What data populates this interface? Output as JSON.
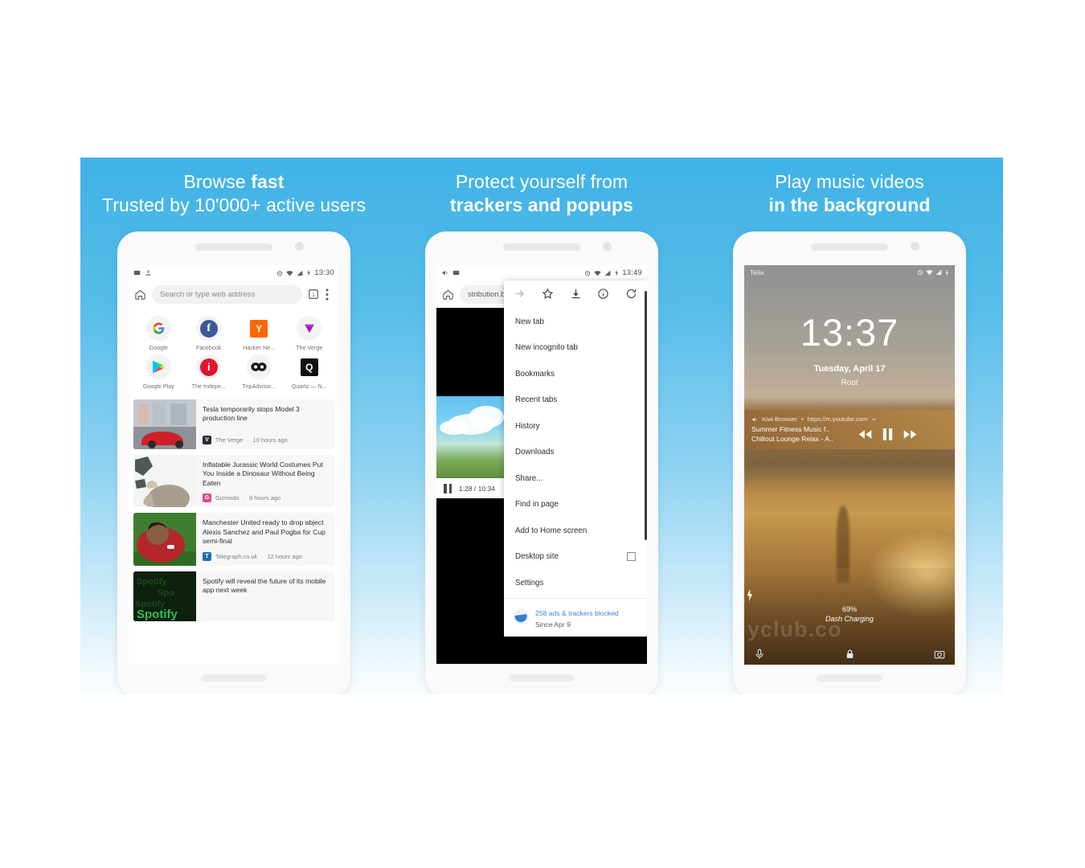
{
  "panels": [
    {
      "headline_line1": "Browse fast",
      "headline_line1_plain": "Browse ",
      "headline_line1_bold": "fast",
      "headline_line2_plain": "Trusted by 10'000+ active users",
      "headline_line2_bold": ""
    },
    {
      "headline_line1_plain": "Protect yourself from",
      "headline_line2_bold": "trackers and popups"
    },
    {
      "headline_line1_plain": "Play music videos",
      "headline_line2_bold": "in the background"
    }
  ],
  "phone1": {
    "status": {
      "time": "13:30",
      "icons": [
        "screenshot-icon",
        "download-icon",
        "alarm-icon",
        "wifi-icon",
        "signal-icon",
        "battery-charging-icon"
      ]
    },
    "toolbar": {
      "home_icon": "home-icon",
      "omnibox_placeholder": "Search or type web address",
      "tabs_icon": "tab-switcher-icon",
      "menu_icon": "overflow-menu-icon"
    },
    "tiles": [
      {
        "label": "Google",
        "glyph": "G",
        "kind": "google"
      },
      {
        "label": "Facebook",
        "glyph": "f",
        "kind": "facebook"
      },
      {
        "label": "Hacker Ne...",
        "glyph": "Y",
        "kind": "hackernews"
      },
      {
        "label": "The Verge",
        "glyph": "V",
        "kind": "verge"
      },
      {
        "label": "Google Play",
        "glyph": "▶",
        "kind": "googleplay"
      },
      {
        "label": "The Indepe...",
        "glyph": "ⓨ",
        "kind": "independent"
      },
      {
        "label": "TripAdvisor...",
        "glyph": "◉◉",
        "kind": "tripadvisor"
      },
      {
        "label": "Quartz — N...",
        "glyph": "Q",
        "kind": "quartz"
      }
    ],
    "articles": [
      {
        "title": "Tesla temporarily stops Model 3 production line",
        "source": "The Verge",
        "age": "10 hours ago",
        "favicon_glyph": "V",
        "favicon_color": "#2b2b3a",
        "thumb": "tesla-red-car-photo"
      },
      {
        "title": "Inflatable Jurassic World Costumes Put You Inside a Dinosaur Without Being Eaten",
        "source": "Gizmodo",
        "age": "9 hours ago",
        "favicon_glyph": "G",
        "favicon_color": "#d94c8e",
        "thumb": "dinosaur-photo"
      },
      {
        "title": "Manchester United ready to drop abject Alexis Sanchez and Paul Pogba for Cup semi-final",
        "source": "Telegraph.co.uk",
        "age": "12 hours ago",
        "favicon_glyph": "T",
        "favicon_color": "#1f6fb2",
        "thumb": "footballer-photo"
      },
      {
        "title": "Spotify will reveal the future of its mobile app next week",
        "source": "",
        "age": "",
        "favicon_glyph": "",
        "favicon_color": "",
        "thumb": "spotify-logo-photo"
      }
    ],
    "meta_separator": "·"
  },
  "phone2": {
    "status": {
      "time": "13:49",
      "icons": [
        "volume-icon",
        "screenshot-icon",
        "alarm-icon",
        "wifi-icon",
        "signal-icon",
        "battery-charging-icon"
      ]
    },
    "toolbar": {
      "home_icon": "home-icon",
      "url": "stribution.bb"
    },
    "video": {
      "position": "1:28 / 10:34",
      "play_state_icon": "pause-icon"
    },
    "menu": {
      "top_icons": [
        "forward-arrow-icon",
        "bookmark-star-icon",
        "download-icon",
        "page-info-icon",
        "reload-icon"
      ],
      "items": [
        {
          "label": "New tab",
          "checkbox": false
        },
        {
          "label": "New incognito tab",
          "checkbox": false
        },
        {
          "label": "Bookmarks",
          "checkbox": false
        },
        {
          "label": "Recent tabs",
          "checkbox": false
        },
        {
          "label": "History",
          "checkbox": false
        },
        {
          "label": "Downloads",
          "checkbox": false
        },
        {
          "label": "Share...",
          "checkbox": false
        },
        {
          "label": "Find in page",
          "checkbox": false
        },
        {
          "label": "Add to Home screen",
          "checkbox": false
        },
        {
          "label": "Desktop site",
          "checkbox": true
        },
        {
          "label": "Settings",
          "checkbox": false
        }
      ],
      "footer_line1": "258 ads & trackers blocked",
      "footer_line2": "Since Apr 9",
      "footer_icon": "kiwi-browser-icon",
      "footer_link_color": "#3f82d8"
    }
  },
  "phone3": {
    "status": {
      "carrier": "Telia",
      "icons": [
        "alarm-icon",
        "wifi-icon",
        "signal-icon",
        "battery-charging-icon"
      ]
    },
    "clock": {
      "time": "13:37",
      "date": "Tuesday, April 17",
      "owner": "Root"
    },
    "media": {
      "app": "Kiwi Browser",
      "separator": "•",
      "url": "https://m.youtube.com",
      "expand_icon": "chevron-down-icon",
      "volume_icon": "volume-icon",
      "title_line1": "Summer Fitness Music f..",
      "title_line2": "Chillout Lounge Relax - A..",
      "controls": [
        "rewind-icon",
        "pause-icon",
        "fast-forward-icon"
      ]
    },
    "charging": {
      "bolt_icon": "charging-bolt-icon",
      "percent": "69%",
      "label": "Dash Charging",
      "lock_icon": "lock-icon"
    },
    "bottom": {
      "left_icon": "microphone-icon",
      "right_icon": "camera-icon"
    },
    "watermark": "yclub.co"
  },
  "colors": {
    "banner_top": "#3fb2e6",
    "banner_bottom": "#fbfdfe",
    "accent_link": "#3f82d8",
    "phone_body": "#fafafa"
  }
}
